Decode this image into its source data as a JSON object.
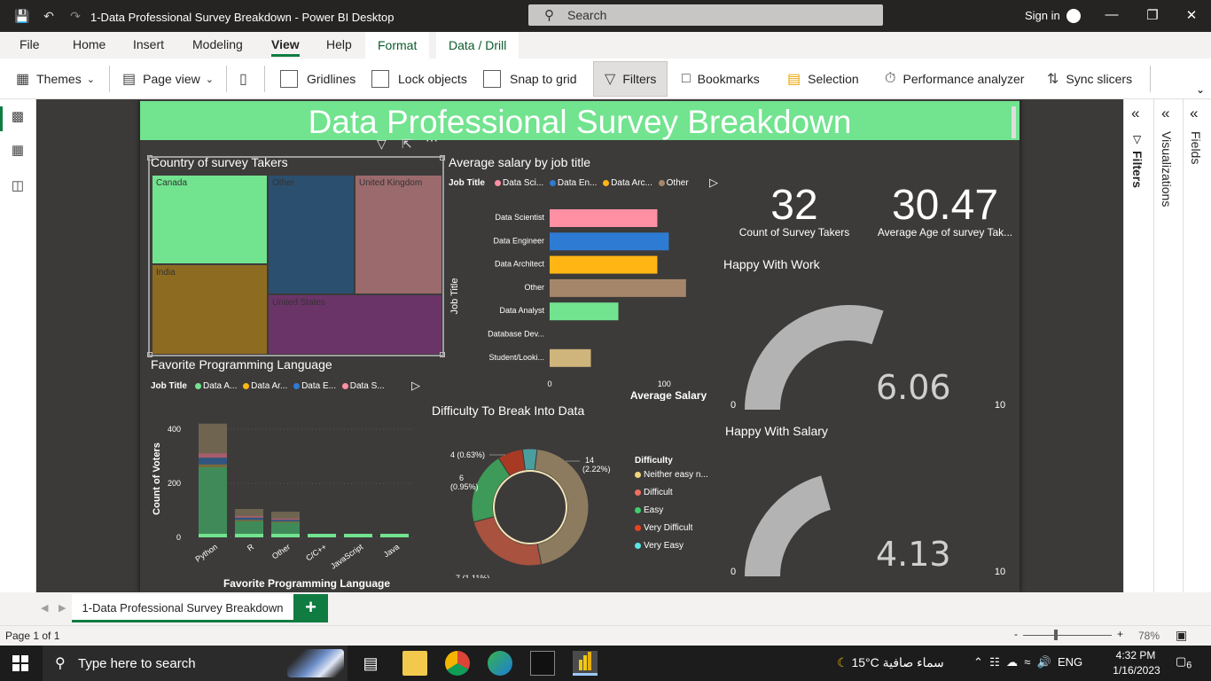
{
  "window": {
    "title": "1-Data Professional Survey Breakdown - Power BI Desktop",
    "search_placeholder": "Search",
    "sign_in": "Sign in"
  },
  "menu": {
    "tabs": [
      "File",
      "Home",
      "Insert",
      "Modeling",
      "View",
      "Help",
      "Format",
      "Data / Drill"
    ],
    "active": "View"
  },
  "ribbon": {
    "themes": "Themes",
    "page_view": "Page view",
    "gridlines": "Gridlines",
    "lock_objects": "Lock objects",
    "snap_to_grid": "Snap to grid",
    "filters": "Filters",
    "bookmarks": "Bookmarks",
    "selection": "Selection",
    "performance_analyzer": "Performance analyzer",
    "sync_slicers": "Sync slicers"
  },
  "report": {
    "title": "Data Professional Survey Breakdown",
    "kpi_count": {
      "value": "32",
      "label": "Count of Survey Takers"
    },
    "kpi_age": {
      "value": "30.47",
      "label": "Average Age of survey Tak..."
    }
  },
  "treemap": {
    "title": "Country of survey Takers",
    "cells": [
      {
        "label": "Canada",
        "color": "#72e38f"
      },
      {
        "label": "Other",
        "color": "#2b4f6e"
      },
      {
        "label": "United Kingdom",
        "color": "#9b6a6c"
      },
      {
        "label": "India",
        "color": "#8d6b21"
      },
      {
        "label": "United States",
        "color": "#6b3468"
      }
    ]
  },
  "salary_chart": {
    "title": "Average salary by job title",
    "legend_title": "Job Title",
    "legend": [
      {
        "name": "Data Sci...",
        "color": "#ff8fa3"
      },
      {
        "name": "Data En...",
        "color": "#2d7bd2"
      },
      {
        "name": "Data Arc...",
        "color": "#ffb614"
      },
      {
        "name": "Other",
        "color": "#a6866a"
      }
    ],
    "ylabel": "Job Title",
    "xlabel": "Average Salary",
    "x_ticks": [
      "0",
      "100"
    ]
  },
  "language_chart": {
    "title": "Favorite Programming Language",
    "legend_title": "Job Title",
    "legend": [
      {
        "name": "Data A...",
        "color": "#72e38f"
      },
      {
        "name": "Data Ar...",
        "color": "#ffb614"
      },
      {
        "name": "Data E...",
        "color": "#2d7bd2"
      },
      {
        "name": "Data S...",
        "color": "#ff8fa3"
      }
    ],
    "ylabel": "Count of Voters",
    "xlabel": "Favorite Programming Language",
    "y_ticks": [
      "0",
      "200",
      "400"
    ]
  },
  "donut_chart": {
    "title": "Difficulty To Break Into Data",
    "legend_title": "Difficulty",
    "legend": [
      {
        "name": "Neither easy n...",
        "color": "#f3d57a"
      },
      {
        "name": "Difficult",
        "color": "#ef7062"
      },
      {
        "name": "Easy",
        "color": "#3fcf6a"
      },
      {
        "name": "Very Difficult",
        "color": "#e8431e"
      },
      {
        "name": "Very Easy",
        "color": "#5ce6e6"
      }
    ],
    "labels": {
      "top_right_a": "14",
      "top_right_b": "(2.22%)",
      "top_left": "4 (0.63%)",
      "left_a": "6",
      "left_b": "(0.95%)",
      "bottom": "7 (1.11%)"
    }
  },
  "gauge_work": {
    "title": "Happy With Work",
    "value_label": "6.06",
    "min_label": "0",
    "max_label": "10"
  },
  "gauge_salary": {
    "title": "Happy With Salary",
    "value_label": "4.13",
    "min_label": "0",
    "max_label": "10"
  },
  "chart_data": [
    {
      "type": "bar",
      "title": "Average salary by job title",
      "categories": [
        "Data Scientist",
        "Data Engineer",
        "Data Architect",
        "Other",
        "Data Analyst",
        "Database Dev...",
        "Student/Looki..."
      ],
      "values": [
        94,
        104,
        94,
        119,
        60,
        0,
        36
      ],
      "colors": [
        "#ff8fa3",
        "#2d7bd2",
        "#ffb614",
        "#a6866a",
        "#72e38f",
        "#5ce6e6",
        "#cfb57c"
      ],
      "xlabel": "Average Salary",
      "ylabel": "Job Title",
      "xlim": [
        0,
        130
      ]
    },
    {
      "type": "bar",
      "title": "Favorite Programming Language",
      "categories": [
        "Python",
        "R",
        "Other",
        "C/C++",
        "JavaScript",
        "Java"
      ],
      "totals": [
        421,
        105,
        95,
        9,
        9,
        2
      ],
      "series": [
        {
          "name": "Data A...",
          "values": [
            260,
            60,
            55,
            5,
            5,
            1
          ],
          "color": "#3f8a58"
        },
        {
          "name": "Data Ar...",
          "values": [
            10,
            5,
            4,
            1,
            1,
            0
          ],
          "color": "#7a6a3c"
        },
        {
          "name": "Data E...",
          "values": [
            25,
            8,
            6,
            1,
            1,
            0
          ],
          "color": "#2f5580"
        },
        {
          "name": "Data S...",
          "values": [
            16,
            6,
            5,
            1,
            1,
            1
          ],
          "color": "#a65d6b"
        }
      ],
      "xlabel": "Favorite Programming Language",
      "ylabel": "Count of Voters",
      "ylim": [
        0,
        430
      ]
    },
    {
      "type": "pie",
      "title": "Difficulty To Break Into Data",
      "donut": true,
      "slices": [
        {
          "name": "Neither easy n...",
          "value": 45,
          "color": "#8c7b5e"
        },
        {
          "name": "Difficult",
          "value": 24,
          "color": "#a8523f"
        },
        {
          "name": "Easy",
          "value": 20,
          "color": "#3e9a58"
        },
        {
          "name": "Very Difficult",
          "value": 7,
          "color": "#a83a24"
        },
        {
          "name": "Very Easy",
          "value": 4,
          "color": "#4a9e9e"
        }
      ]
    },
    {
      "type": "gauge",
      "title": "Happy With Work",
      "value": 6.06,
      "min": 0,
      "max": 10
    },
    {
      "type": "gauge",
      "title": "Happy With Salary",
      "value": 4.13,
      "min": 0,
      "max": 10
    }
  ],
  "pages": {
    "tab": "1-Data Professional Survey Breakdown",
    "add": "+",
    "status": "Page 1 of 1",
    "zoom": "78%"
  },
  "panes": {
    "filters": "Filters",
    "visualizations": "Visualizations",
    "fields": "Fields"
  },
  "taskbar": {
    "search": "Type here to search",
    "weather": "15°C  سماء صافية",
    "lang": "ENG",
    "time": "4:32 PM",
    "date": "1/16/2023",
    "notifications": "6"
  }
}
